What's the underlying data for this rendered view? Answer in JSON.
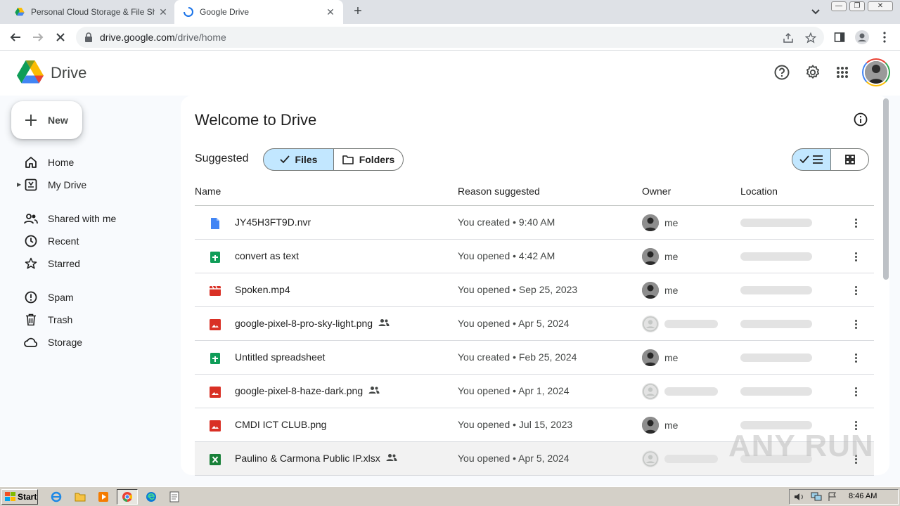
{
  "browser": {
    "tabs": [
      {
        "title": "Personal Cloud Storage & File Sharing",
        "active": false
      },
      {
        "title": "Google Drive",
        "active": true
      }
    ],
    "url_host": "drive.google.com",
    "url_path": "/drive/home"
  },
  "app": {
    "brand": "Drive",
    "new_label": "New"
  },
  "sidebar": {
    "items": [
      {
        "label": "Home",
        "icon": "home-icon"
      },
      {
        "label": "My Drive",
        "icon": "my-drive-icon"
      },
      {
        "label": "Shared with me",
        "icon": "people-icon"
      },
      {
        "label": "Recent",
        "icon": "clock-icon"
      },
      {
        "label": "Starred",
        "icon": "star-icon"
      },
      {
        "label": "Spam",
        "icon": "spam-icon"
      },
      {
        "label": "Trash",
        "icon": "trash-icon"
      },
      {
        "label": "Storage",
        "icon": "cloud-icon"
      }
    ]
  },
  "main": {
    "title": "Welcome to Drive",
    "suggested_label": "Suggested",
    "filter_files": "Files",
    "filter_folders": "Folders",
    "columns": [
      "Name",
      "Reason suggested",
      "Owner",
      "Location"
    ],
    "rows": [
      {
        "name": "JY45H3FT9D.nvr",
        "type": "doc",
        "shared": false,
        "reason": "You created • 9:40 AM",
        "owner": "me"
      },
      {
        "name": "convert as text",
        "type": "sheet",
        "shared": false,
        "reason": "You opened • 4:42 AM",
        "owner": "me"
      },
      {
        "name": "Spoken.mp4",
        "type": "video",
        "shared": false,
        "reason": "You opened • Sep 25, 2023",
        "owner": "me"
      },
      {
        "name": "google-pixel-8-pro-sky-light.png",
        "type": "image",
        "shared": true,
        "reason": "You opened • Apr 5, 2024",
        "owner": ""
      },
      {
        "name": "Untitled spreadsheet",
        "type": "sheet",
        "shared": false,
        "reason": "You created • Feb 25, 2024",
        "owner": "me"
      },
      {
        "name": "google-pixel-8-haze-dark.png",
        "type": "image",
        "shared": true,
        "reason": "You opened • Apr 1, 2024",
        "owner": ""
      },
      {
        "name": "CMDI ICT CLUB.png",
        "type": "image",
        "shared": false,
        "reason": "You opened • Jul 15, 2023",
        "owner": "me"
      },
      {
        "name": "Paulino & Carmona Public IP.xlsx",
        "type": "excel",
        "shared": true,
        "reason": "You opened • Apr 5, 2024",
        "owner": ""
      }
    ]
  },
  "taskbar": {
    "start_label": "Start",
    "clock": "8:46 AM"
  },
  "watermark": "ANY RUN",
  "colors": {
    "accent": "#0b57d0",
    "selected_bg": "#c2e7ff",
    "doc_blue": "#4285f4",
    "sheet_green": "#0f9d58",
    "image_red": "#d93025"
  }
}
